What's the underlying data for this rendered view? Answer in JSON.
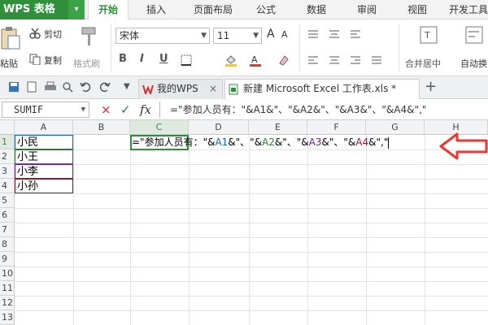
{
  "app": {
    "title": "WPS 表格",
    "caret": "▾"
  },
  "menu": [
    {
      "label": "开始",
      "active": true
    },
    {
      "label": "插入"
    },
    {
      "label": "页面布局"
    },
    {
      "label": "公式"
    },
    {
      "label": "数据"
    },
    {
      "label": "审阅"
    },
    {
      "label": "视图"
    },
    {
      "label": "开发工具"
    }
  ],
  "ribbon": {
    "paste": "粘贴",
    "cut": "剪切",
    "copy": "复制",
    "format_painter": "格式刷",
    "font_name": "宋体",
    "font_size": "11",
    "bold": "B",
    "italic": "I",
    "underline": "U",
    "merge": "合并居中",
    "wrap": "自动换",
    "grow": "A",
    "shrink": "A"
  },
  "tabs": {
    "tab1": "我的WPS",
    "tab2": "新建 Microsoft Excel 工作表.xls *",
    "close": "×",
    "plus": "+"
  },
  "formula_bar": {
    "name_box": "SUMIF",
    "cancel": "×",
    "confirm": "✓",
    "fx": "fx",
    "formula": "=\"参加人员有：\"&A1&\"、\"&A2&\"、\"&A3&\"、\"&A4&\",\""
  },
  "columns": [
    "A",
    "B",
    "C",
    "D",
    "E",
    "F",
    "G",
    "H"
  ],
  "rows": [
    "1",
    "2",
    "3",
    "4",
    "5",
    "6",
    "7",
    "8",
    "9",
    "10",
    "11",
    "12",
    "13"
  ],
  "cells": {
    "A1": "小民",
    "A2": "小王",
    "A3": "小李",
    "A4": "小孙"
  },
  "edit_cell": {
    "p1": "=\"参加人员有：\"&",
    "r1": "A1",
    "p2": "&\"、\"&",
    "r2": "A2",
    "p3": "&\"、\"&",
    "r3": "A3",
    "p4": "&\"、\"&",
    "r4": "A4",
    "p5": "&\",\""
  },
  "colors": {
    "brand_green": "#2f8f3a",
    "arrow_red": "#e53935"
  },
  "icons": [
    "paste-icon",
    "cut-icon",
    "copy-icon",
    "format-painter-icon",
    "save-icon",
    "undo-icon",
    "redo-icon",
    "wps-logo-icon",
    "sheet-icon",
    "arrow-left-icon"
  ]
}
